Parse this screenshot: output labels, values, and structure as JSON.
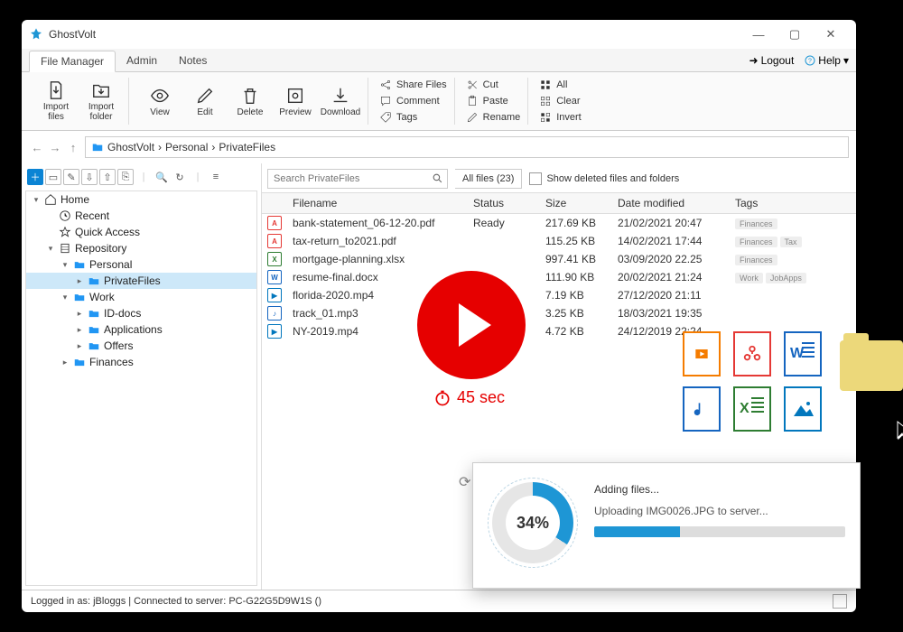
{
  "app_title": "GhostVolt",
  "tabs": [
    "File Manager",
    "Admin",
    "Notes"
  ],
  "logout": "Logout",
  "help": "Help",
  "ribbon": {
    "import_files": "Import\nfiles",
    "import_folder": "Import\nfolder",
    "view": "View",
    "edit": "Edit",
    "delete": "Delete",
    "preview": "Preview",
    "download": "Download",
    "share": "Share Files",
    "comment": "Comment",
    "tags": "Tags",
    "cut": "Cut",
    "paste": "Paste",
    "rename": "Rename",
    "all": "All",
    "clear": "Clear",
    "invert": "Invert"
  },
  "breadcrumb": [
    "GhostVolt",
    "Personal",
    "PrivateFiles"
  ],
  "search_placeholder": "Search PrivateFiles",
  "filter": "All files (23)",
  "show_deleted": "Show deleted files and folders",
  "tree": [
    {
      "indent": 0,
      "icon": "home",
      "label": "Home",
      "caret": "▾"
    },
    {
      "indent": 1,
      "icon": "recent",
      "label": "Recent"
    },
    {
      "indent": 1,
      "icon": "star",
      "label": "Quick Access"
    },
    {
      "indent": 1,
      "icon": "repo",
      "label": "Repository",
      "caret": "▾"
    },
    {
      "indent": 2,
      "icon": "folder",
      "label": "Personal",
      "caret": "▾"
    },
    {
      "indent": 3,
      "icon": "folder",
      "label": "PrivateFiles",
      "caret": "▸",
      "selected": true
    },
    {
      "indent": 2,
      "icon": "folder",
      "label": "Work",
      "caret": "▾"
    },
    {
      "indent": 3,
      "icon": "folder",
      "label": "ID-docs",
      "caret": "▸"
    },
    {
      "indent": 3,
      "icon": "folder",
      "label": "Applications",
      "caret": "▸"
    },
    {
      "indent": 3,
      "icon": "folder",
      "label": "Offers",
      "caret": "▸"
    },
    {
      "indent": 2,
      "icon": "folder",
      "label": "Finances",
      "caret": "▸"
    }
  ],
  "columns": {
    "filename": "Filename",
    "status": "Status",
    "size": "Size",
    "date": "Date modified",
    "tags": "Tags"
  },
  "files": [
    {
      "ic": "pdf",
      "name": "bank-statement_06-12-20.pdf",
      "status": "Ready",
      "size": "217.69 KB",
      "date": "21/02/2021 20:47",
      "tags": [
        "Finances"
      ]
    },
    {
      "ic": "pdf",
      "name": "tax-return_to2021.pdf",
      "status": "",
      "size": "115.25 KB",
      "date": "14/02/2021 17:44",
      "tags": [
        "Finances",
        "Tax"
      ]
    },
    {
      "ic": "xls",
      "name": "mortgage-planning.xlsx",
      "status": "",
      "size": "997.41 KB",
      "date": "03/09/2020 22.25",
      "tags": [
        "Finances"
      ]
    },
    {
      "ic": "doc",
      "name": "resume-final.docx",
      "status": "",
      "size": "111.90 KB",
      "date": "20/02/2021 21:24",
      "tags": [
        "Work",
        "JobApps"
      ]
    },
    {
      "ic": "vid",
      "name": "florida-2020.mp4",
      "status": "",
      "size": "7.19 KB",
      "date": "27/12/2020 21:11",
      "tags": []
    },
    {
      "ic": "aud",
      "name": "track_01.mp3",
      "status": "",
      "size": "3.25 KB",
      "date": "18/03/2021 19:35",
      "tags": []
    },
    {
      "ic": "vid",
      "name": "NY-2019.mp4",
      "status": "",
      "size": "4.72 KB",
      "date": "24/12/2019 22:24",
      "tags": []
    }
  ],
  "timer": "45 sec",
  "upload": {
    "pct": "34%",
    "heading": "Adding files...",
    "status": "Uploading IMG0026.JPG to server...",
    "progress": 34
  },
  "status": "Logged in as: jBloggs    |    Connected to server: PC-G22G5D9W1S ()"
}
